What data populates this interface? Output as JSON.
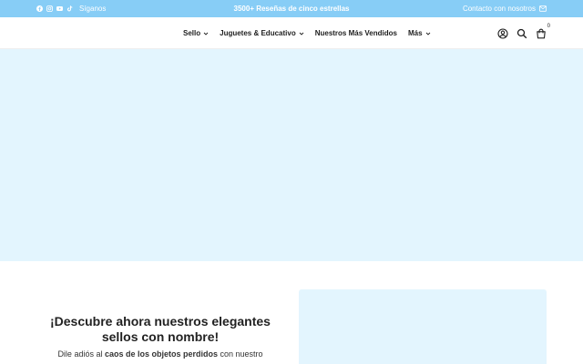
{
  "topbar": {
    "socials": [
      {
        "icon": "facebook-icon"
      },
      {
        "icon": "instagram-icon"
      },
      {
        "icon": "youtube-icon"
      },
      {
        "icon": "tiktok-icon"
      }
    ],
    "follow_label": "Síganos",
    "announcement": "3500+ Reseñas de cinco estrellas",
    "contact_label": "Contacto con nosotros",
    "contact_icon": "mail-icon",
    "bg_color": "#87cdf6"
  },
  "nav": {
    "items": [
      {
        "label": "Sello",
        "dropdown": true
      },
      {
        "label": "Juguetes & Educativo",
        "dropdown": true
      },
      {
        "label": "Nuestros Más Vendidos",
        "dropdown": false
      },
      {
        "label": "Más",
        "dropdown": true
      }
    ]
  },
  "header_icons": {
    "account": "account-icon",
    "search": "search-icon",
    "cart": "cart-icon",
    "cart_count": "0"
  },
  "hero": {
    "bg_color": "#e3f5fe"
  },
  "section": {
    "heading": "¡Descubre ahora nuestros elegantes sellos con nombre!",
    "desc_prefix": "Dile adiós al",
    "desc_bold": "caos de los objetos perdidos",
    "desc_suffix": "con nuestro"
  }
}
